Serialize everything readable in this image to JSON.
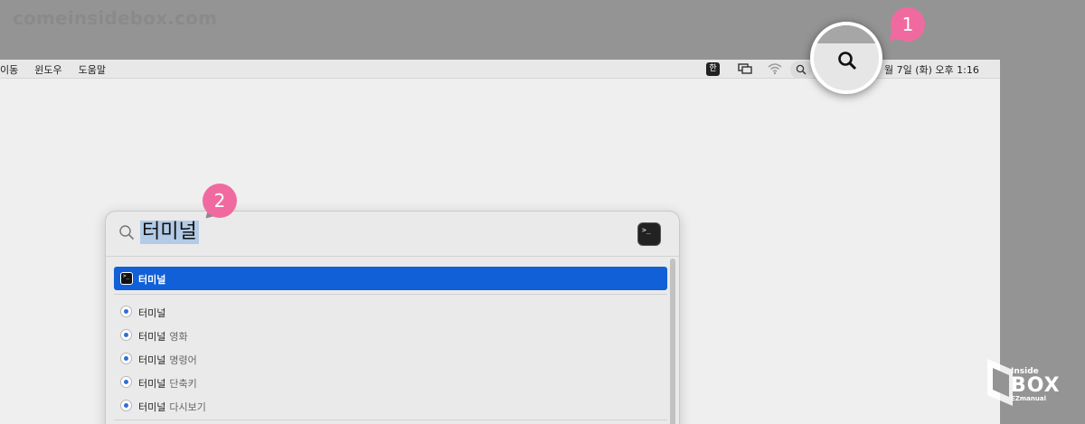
{
  "watermark": "comeinsidebox.com",
  "menubar": {
    "left_items": [
      "이동",
      "윈도우",
      "도움말"
    ],
    "ime_indicator": "한",
    "clock": "월 7일 (화) 오후 1:16"
  },
  "annotations": {
    "badge1": "1",
    "badge2": "2"
  },
  "spotlight": {
    "query": "터미널",
    "top_hit": {
      "label": "터미널",
      "icon": "terminal-icon",
      "icon_text": ">_"
    },
    "suggestions": [
      {
        "query": "터미널",
        "suffix": ""
      },
      {
        "query": "터미널",
        "suffix": "영화"
      },
      {
        "query": "터미널",
        "suffix": "명령어"
      },
      {
        "query": "터미널",
        "suffix": "단축키"
      },
      {
        "query": "터미널",
        "suffix": "다시보기"
      }
    ]
  },
  "logo": {
    "line1": "Inside",
    "line2": "BOX",
    "line3": "EZmanual"
  },
  "colors": {
    "selection": "#1160d8",
    "badge": "#f06aa0",
    "query_highlight": "#b3cbe6"
  }
}
